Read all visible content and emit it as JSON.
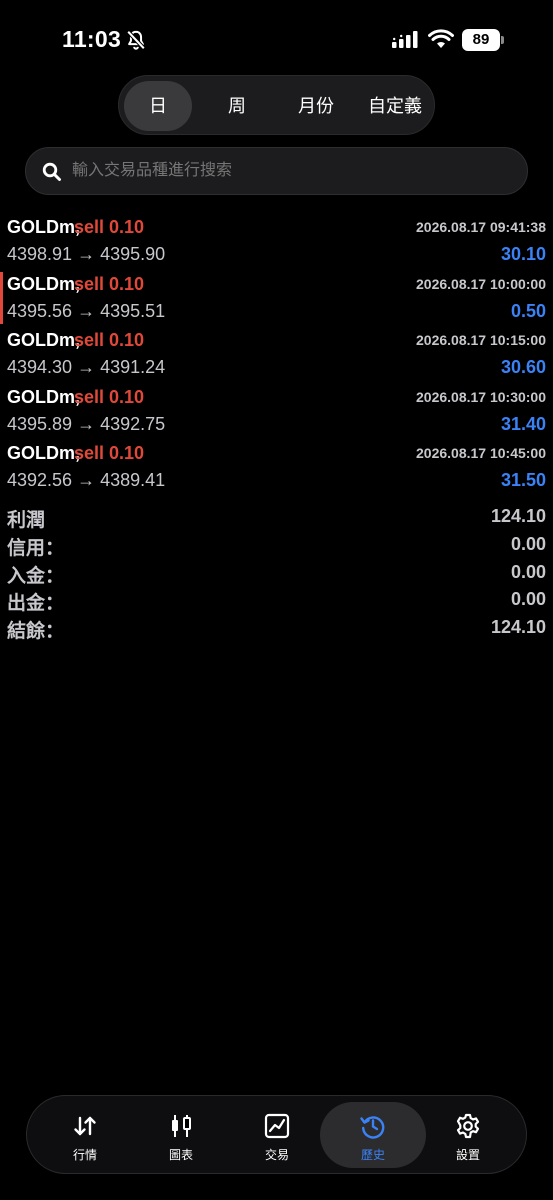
{
  "status_bar": {
    "time": "11:03",
    "battery": "89",
    "icons": [
      "bell-slash-icon",
      "signal-icon",
      "wifi-icon",
      "battery-icon"
    ]
  },
  "period_tabs": [
    {
      "label": "日",
      "active": true
    },
    {
      "label": "周",
      "active": false
    },
    {
      "label": "月份",
      "active": false
    },
    {
      "label": "自定義",
      "active": false
    }
  ],
  "search": {
    "placeholder": "輸入交易品種進行搜索"
  },
  "trades": [
    {
      "symbol": "GOLDm,",
      "side": "sell 0.10",
      "open": "4398.91",
      "arrow": "→",
      "close": "4395.90",
      "time": "2026.08.17 09:41:38",
      "profit": "30.10"
    },
    {
      "symbol": "GOLDm,",
      "side": "sell 0.10",
      "open": "4395.56",
      "arrow": "→",
      "close": "4395.51",
      "time": "2026.08.17 10:00:00",
      "profit": "0.50"
    },
    {
      "symbol": "GOLDm,",
      "side": "sell 0.10",
      "open": "4394.30",
      "arrow": "→",
      "close": "4391.24",
      "time": "2026.08.17 10:15:00",
      "profit": "30.60"
    },
    {
      "symbol": "GOLDm,",
      "side": "sell 0.10",
      "open": "4395.89",
      "arrow": "→",
      "close": "4392.75",
      "time": "2026.08.17 10:30:00",
      "profit": "31.40"
    },
    {
      "symbol": "GOLDm,",
      "side": "sell 0.10",
      "open": "4392.56",
      "arrow": "→",
      "close": "4389.41",
      "time": "2026.08.17 10:45:00",
      "profit": "31.50"
    }
  ],
  "summary": [
    {
      "label": "利潤",
      "value": "124.10"
    },
    {
      "label": "信用：",
      "value": "0.00"
    },
    {
      "label": "入金：",
      "value": "0.00"
    },
    {
      "label": "出金：",
      "value": "0.00"
    },
    {
      "label": "結餘：",
      "value": "124.10"
    }
  ],
  "bottom_nav": [
    {
      "label": "行情",
      "icon": "quotes-arrows-icon",
      "active": false
    },
    {
      "label": "圖表",
      "icon": "candlestick-chart-icon",
      "active": false
    },
    {
      "label": "交易",
      "icon": "trade-chart-icon",
      "active": false
    },
    {
      "label": "歷史",
      "icon": "history-clock-icon",
      "active": true
    },
    {
      "label": "設置",
      "icon": "settings-gear-icon",
      "active": false
    }
  ],
  "colors": {
    "sell": "#e0483a",
    "profit": "#3b82f6",
    "active_nav": "#3b82f6",
    "background": "#000000"
  }
}
